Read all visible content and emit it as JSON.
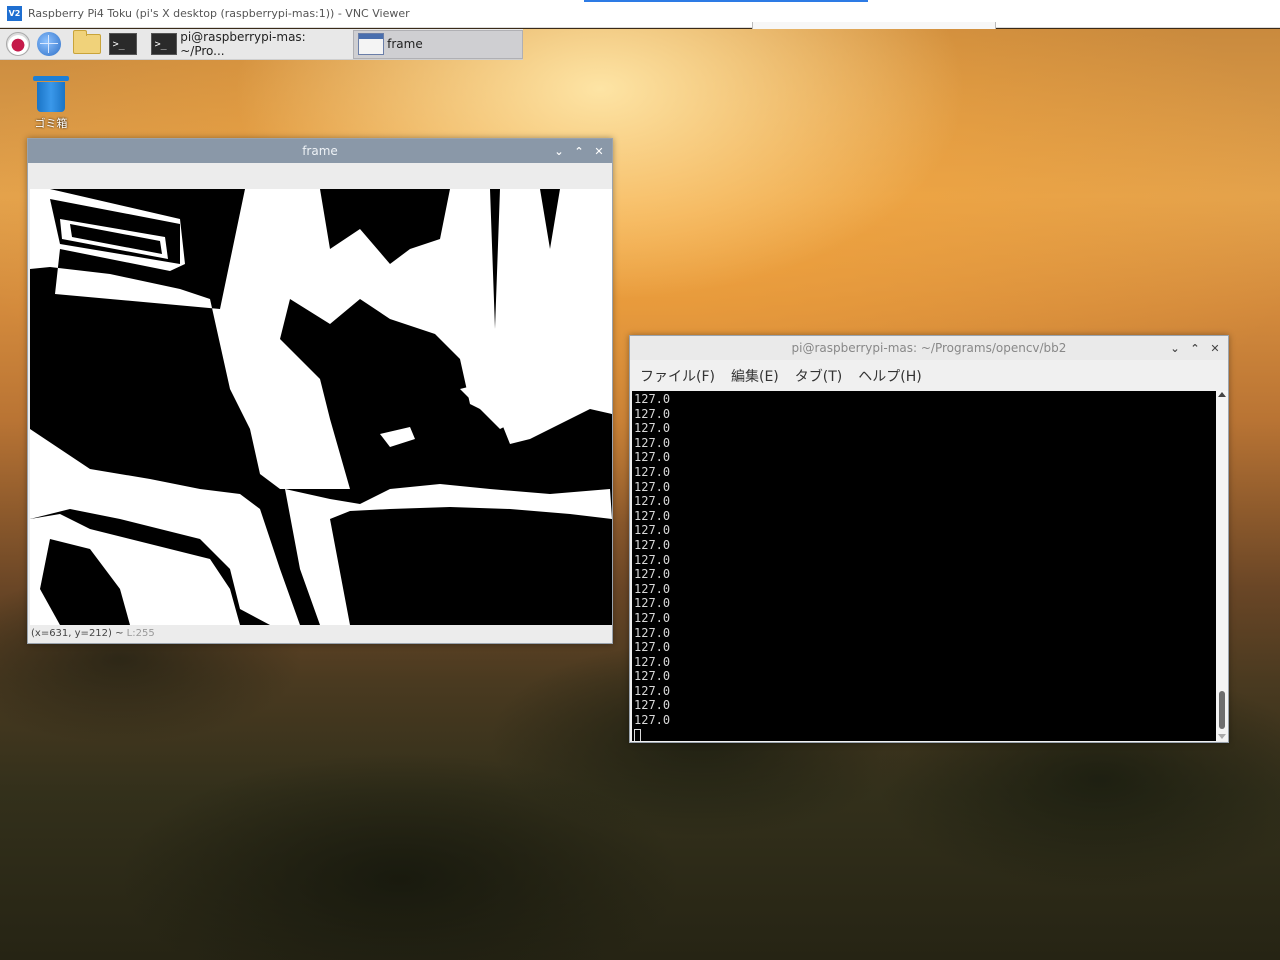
{
  "vnc": {
    "title": "Raspberry Pi4 Toku (pi's X desktop (raspberrypi-mas:1)) - VNC Viewer",
    "logo_text": "V2"
  },
  "taskbar": {
    "task_terminal_label": "pi@raspberrypi-mas: ~/Pro...",
    "task_frame_label": "frame"
  },
  "desktop": {
    "trash_label": "ゴミ箱"
  },
  "frame_window": {
    "title": "frame",
    "status_coords": "(x=631, y=212) ~ ",
    "status_value": "L:255"
  },
  "terminal_window": {
    "title": "pi@raspberrypi-mas: ~/Programs/opencv/bb2",
    "menu": [
      "ファイル(F)",
      "編集(E)",
      "タブ(T)",
      "ヘルプ(H)"
    ],
    "lines": [
      "127.0",
      "127.0",
      "127.0",
      "127.0",
      "127.0",
      "127.0",
      "127.0",
      "127.0",
      "127.0",
      "127.0",
      "127.0",
      "127.0",
      "127.0",
      "127.0",
      "127.0",
      "127.0",
      "127.0",
      "127.0",
      "127.0",
      "127.0",
      "127.0",
      "127.0",
      "127.0"
    ]
  },
  "icons": {
    "minimize": "⌄",
    "maximize": "⌃",
    "close": "✕",
    "terminal_prompt": ">_"
  }
}
